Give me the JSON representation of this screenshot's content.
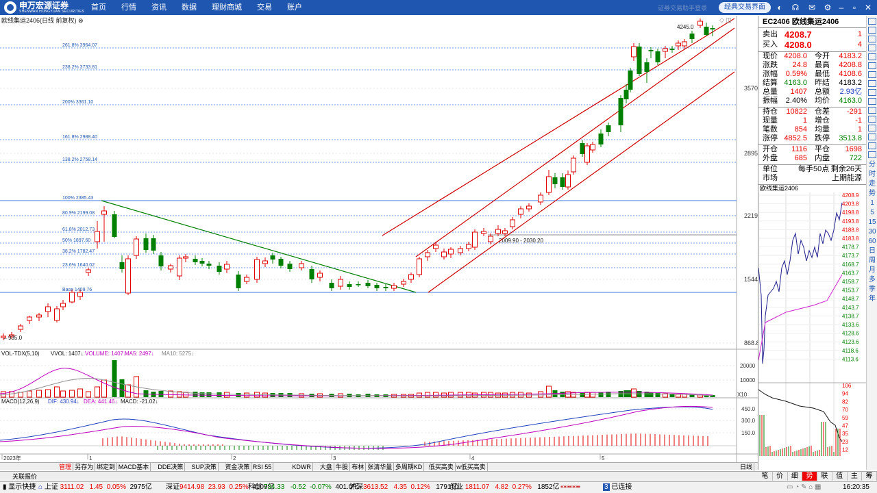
{
  "app": {
    "logo_text": "申万宏源证券",
    "logo_sub": "SHENWAN HONGYUAN SECURITIES",
    "login_text": "证券交易助手登录",
    "classic_btn": "经典交易界面"
  },
  "nav": [
    "首页",
    "行情",
    "资讯",
    "数据",
    "理财商城",
    "交易",
    "账户"
  ],
  "chart": {
    "title": "欧线集运2406(日线 前复权)",
    "price_ticks": [
      "3570",
      "2895",
      "2219",
      "1544",
      "868.8"
    ],
    "fib_labels": [
      "261.8% 3964.07",
      "238.2% 3733.81",
      "200% 3361.10",
      "161.8% 2988.40",
      "138.2% 2758.14",
      "100% 2385.43",
      "80.9% 2199.08",
      "61.8% 2012.73",
      "50% 1897.60",
      "38.2% 1782.47",
      "23.6% 1640.02",
      "Base 1409.76"
    ],
    "high_label": "4245.0",
    "low_label": "935.0",
    "gap_label": "2009.90 - 2030.20",
    "date_labels": [
      "2023年",
      "1",
      "2",
      "3",
      "4",
      "5"
    ],
    "vol_title": "VOL-TDX(5,10)",
    "vol_vals": [
      "VVOL: 1407",
      "VOLUME: 1407",
      "MA5: 2497",
      "MA10: 5275"
    ],
    "vol_ticks": [
      "20000",
      "10000",
      "X10"
    ],
    "macd_title": "MACD(12,26,9)",
    "macd_vals": [
      "DIF: 430.94",
      "DEA: 441.46",
      "MACD: -21.02"
    ],
    "macd_ticks": [
      "450.0",
      "300.0",
      "150.0"
    ],
    "period": "日线",
    "colors": {
      "up": "#e00000",
      "down": "#008000",
      "fib": "#3b78e7",
      "trend_down": "#008000",
      "channel": "#d00000"
    }
  },
  "tabs": [
    "管理",
    "另存为",
    "绑定到",
    "MACD基本",
    "DDE决策",
    "SUP决策",
    "资金决策",
    "RSI 55",
    "KDWR",
    "大盘",
    "牛股",
    "布林",
    "张清华量",
    "多周期KD",
    "低买高卖",
    "w低买高卖"
  ],
  "quote_btn": "关联报价",
  "panel": {
    "code": "EC2406",
    "name": "欧线集运2406",
    "sell_label": "卖出",
    "sell_price": "4208.7",
    "sell_vol": "1",
    "buy_label": "买入",
    "buy_price": "4208.0",
    "buy_vol": "4",
    "rows1": [
      [
        "现价",
        "4208.0",
        "今开",
        "4183.2"
      ],
      [
        "涨跌",
        "24.8",
        "最高",
        "4208.8"
      ],
      [
        "涨幅",
        "0.59%",
        "最低",
        "4108.6"
      ],
      [
        "结算",
        "4163.0",
        "昨结",
        "4183.2"
      ],
      [
        "总量",
        "1407",
        "总额",
        "2.93亿"
      ],
      [
        "振幅",
        "2.40%",
        "均价",
        "4163.0"
      ]
    ],
    "rows2": [
      [
        "持仓",
        "10822",
        "仓差",
        "-291"
      ],
      [
        "现量",
        "1",
        "增仓",
        "-1"
      ],
      [
        "笔数",
        "854",
        "均量",
        "1"
      ],
      [
        "涨停",
        "4852.5",
        "跌停",
        "3513.8"
      ]
    ],
    "rows3": [
      [
        "开仓",
        "1116",
        "平仓",
        "1698"
      ],
      [
        "外盘",
        "685",
        "内盘",
        "722"
      ]
    ],
    "unit_label": "单位",
    "unit_val": "每手50点",
    "remain": "剩余26天",
    "market_label": "市场",
    "market_val": "上期能源",
    "mini_title": "欧线集运2406",
    "mini_prices": [
      "4208.9",
      "4203.8",
      "4198.8",
      "4193.8",
      "4188.8",
      "4183.8",
      "4178.7",
      "4173.7",
      "4168.7",
      "4163.7",
      "4158.7",
      "4153.7",
      "4148.7",
      "4143.7",
      "4138.7",
      "4133.6",
      "4128.6",
      "4123.6",
      "4118.6",
      "4113.6"
    ],
    "mini_vol": [
      "106",
      "94",
      "82",
      "70",
      "59",
      "47",
      "35",
      "23",
      "12"
    ]
  },
  "right_strip": [
    "分",
    "时",
    "走",
    "势",
    "1",
    "5",
    "15",
    "30",
    "60",
    "日",
    "周",
    "月",
    "多",
    "季",
    "年"
  ],
  "bottom_tabs": [
    "笔",
    "价",
    "细",
    "势",
    "联",
    "值",
    "主",
    "筹"
  ],
  "active_bottom": "势",
  "status": {
    "quick": "显示快捷",
    "sh": [
      "上证",
      "3111.02",
      "1.45",
      "0.05%",
      "2975亿"
    ],
    "sz": [
      "深证",
      "9414.98",
      "23.93",
      "0.25%",
      "4109亿"
    ],
    "kc": [
      "科创",
      "734.33",
      "-0.52",
      "-0.07%",
      "401.0亿"
    ],
    "hs": [
      "沪深",
      "3613.52",
      "4.35",
      "0.12%",
      "1791亿"
    ],
    "cy": [
      "创业",
      "1811.07",
      "4.82",
      "0.27%",
      "1852亿"
    ],
    "conn": "已连接",
    "conn_num": "3",
    "time": "16:20:35"
  }
}
